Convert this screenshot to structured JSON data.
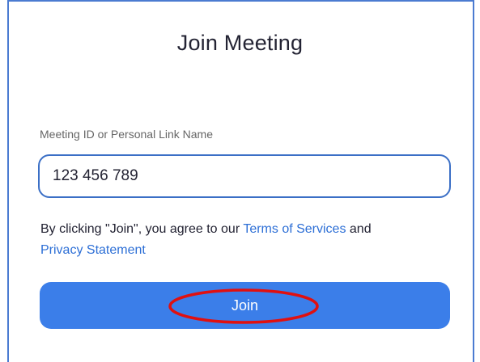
{
  "dialog": {
    "title": "Join Meeting",
    "field_label": "Meeting ID or Personal Link Name",
    "meeting_id_value": "123 456 789",
    "agreement_prefix": "By clicking \"Join\", you agree to our ",
    "terms_link": "Terms of Services",
    "agreement_and": " and",
    "privacy_link": "Privacy Statement",
    "join_label": "Join"
  },
  "colors": {
    "accent": "#3b7ee9",
    "link": "#2d6fd6",
    "input_border": "#3b6fc6",
    "frame_border": "#4b7bd1",
    "annotation": "#e01010"
  }
}
